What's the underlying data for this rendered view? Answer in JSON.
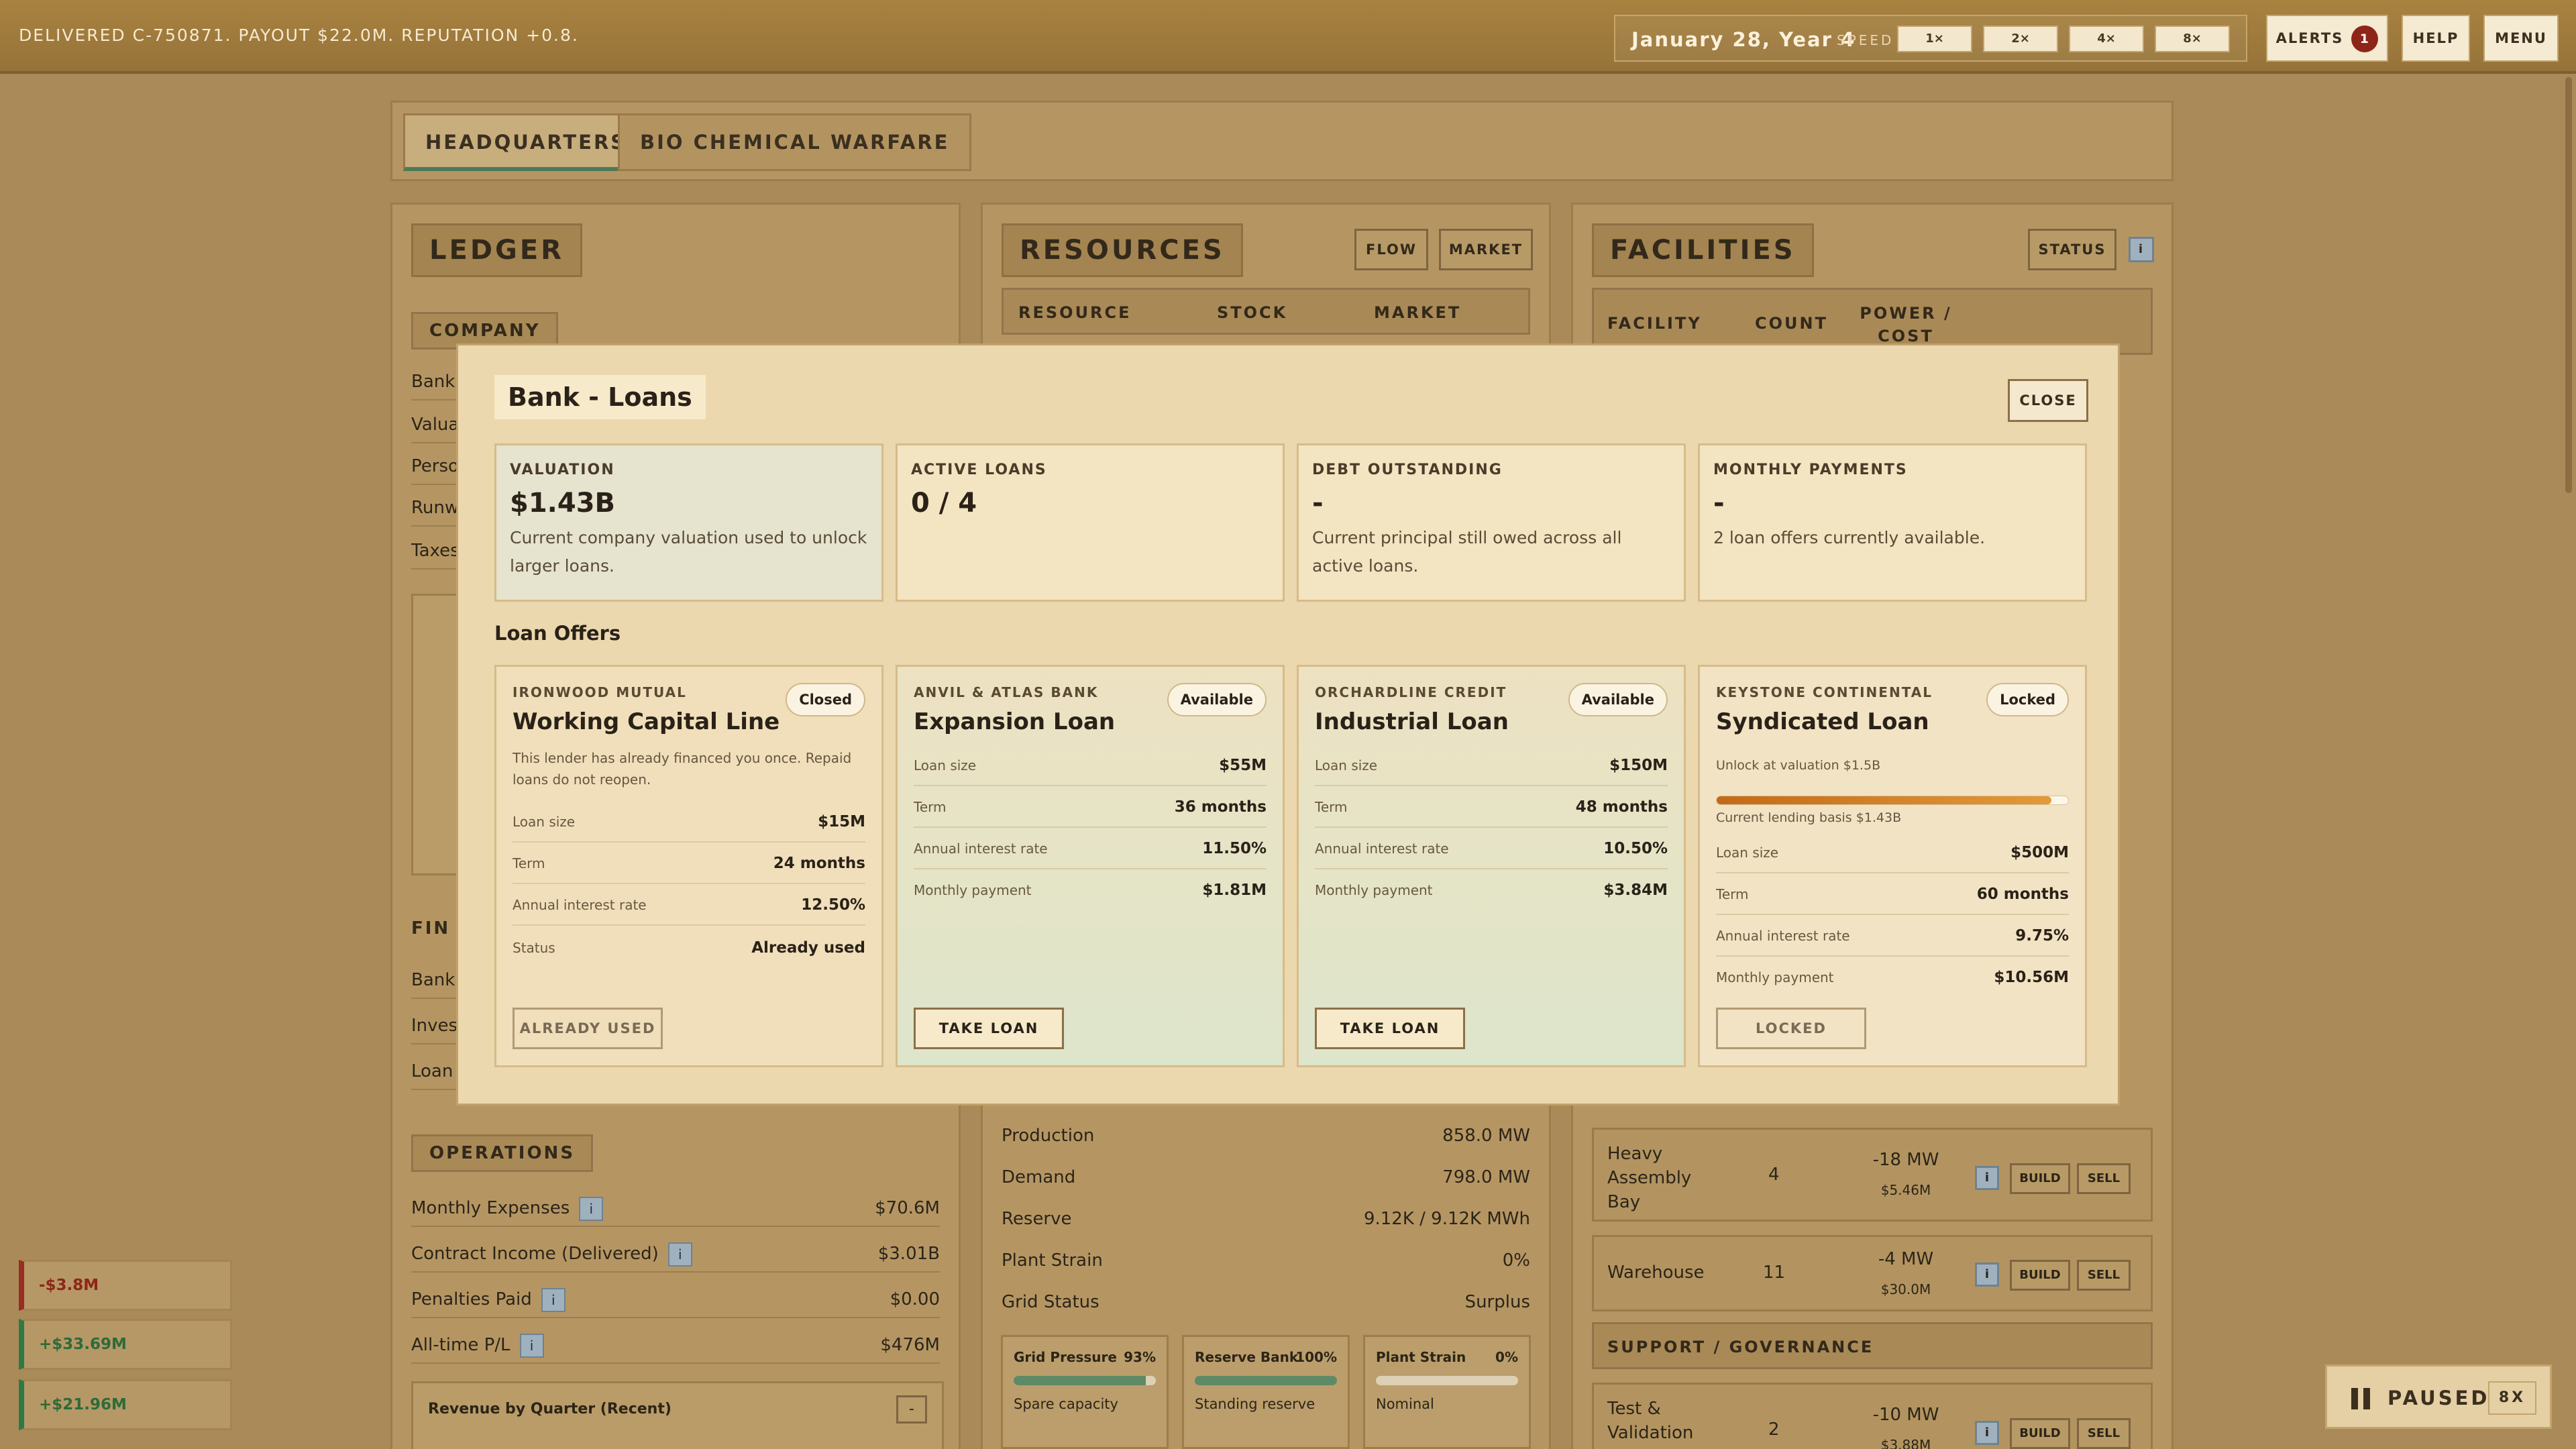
{
  "topbar": {
    "message": "DELIVERED C-750871. PAYOUT $22.0M. REPUTATION +0.8.",
    "date": "January 28, Year 4",
    "speed_label": "SPEED",
    "speeds": [
      "1×",
      "2×",
      "4×",
      "8×"
    ],
    "alerts_label": "ALERTS",
    "alerts_count": "1",
    "help_label": "HELP",
    "menu_label": "MENU"
  },
  "tabs": [
    "HEADQUARTERS",
    "BIO CHEMICAL WARFARE"
  ],
  "ledger": {
    "title": "LEDGER",
    "company_section": "COMPANY",
    "company_rows": [
      "Bank I",
      "Valuat",
      "Perso",
      "Runw",
      "Taxes"
    ],
    "finance_section": "FIN",
    "finance_rows": [
      "Bank I",
      "Invest",
      "Loan I"
    ],
    "operations_section": "OPERATIONS",
    "operations": [
      {
        "label": "Monthly Expenses",
        "value": "$70.6M"
      },
      {
        "label": "Contract Income (Delivered)",
        "value": "$3.01B"
      },
      {
        "label": "Penalties Paid",
        "value": "$0.00"
      },
      {
        "label": "All-time P/L",
        "value": "$476M"
      }
    ],
    "revenue_chart_title": "Revenue by Quarter (Recent)",
    "revenue_chart_btn": "-",
    "info_glyph": "i"
  },
  "resources": {
    "title": "RESOURCES",
    "flow_btn": "FLOW",
    "market_btn": "MARKET",
    "columns": [
      "RESOURCE",
      "STOCK",
      "MARKET"
    ],
    "power_rows": [
      {
        "label": "Production",
        "value": "858.0 MW"
      },
      {
        "label": "Demand",
        "value": "798.0 MW"
      },
      {
        "label": "Reserve",
        "value": "9.12K / 9.12K MWh"
      },
      {
        "label": "Plant Strain",
        "value": "0%"
      },
      {
        "label": "Grid Status",
        "value": "Surplus"
      }
    ],
    "gauges": [
      {
        "label": "Grid Pressure",
        "pct": "93%",
        "fill": 0.93,
        "note": "Spare capacity"
      },
      {
        "label": "Reserve Bank",
        "pct": "100%",
        "fill": 1.0,
        "note": "Standing reserve"
      },
      {
        "label": "Plant Strain",
        "pct": "0%",
        "fill": 0.0,
        "note": "Nominal"
      }
    ]
  },
  "facilities": {
    "title": "FACILITIES",
    "status_btn": "STATUS",
    "info_glyph": "i",
    "columns": [
      "FACILITY",
      "COUNT",
      "POWER / COST"
    ],
    "rows": [
      {
        "name": "Heavy Assembly Bay",
        "count": "4",
        "power": "-18 MW",
        "cost": "$5.46M"
      },
      {
        "name": "Warehouse",
        "count": "11",
        "power": "-4 MW",
        "cost": "$30.0M"
      }
    ],
    "support_section": "SUPPORT / GOVERNANCE",
    "support_rows": [
      {
        "name": "Test & Validation Range",
        "count": "2",
        "power": "-10 MW",
        "cost": "$3.88M"
      }
    ],
    "build_label": "BUILD",
    "sell_label": "SELL"
  },
  "toasts": [
    "-$3.8M",
    "+$33.69M",
    "+$21.96M"
  ],
  "paused": {
    "label": "PAUSED",
    "speed": "8X"
  },
  "modal": {
    "title": "Bank - Loans",
    "close_label": "CLOSE",
    "stats": [
      {
        "label": "VALUATION",
        "value": "$1.43B",
        "desc": "Current company valuation used to unlock larger loans."
      },
      {
        "label": "ACTIVE LOANS",
        "value": "0 / 4",
        "desc": ""
      },
      {
        "label": "DEBT OUTSTANDING",
        "value": "-",
        "desc": "Current principal still owed across all active loans."
      },
      {
        "label": "MONTHLY PAYMENTS",
        "value": "-",
        "desc": "2 loan offers currently available."
      }
    ],
    "offers_heading": "Loan Offers",
    "offers": [
      {
        "lender": "IRONWOOD MUTUAL",
        "name": "Working Capital Line",
        "status": "Closed",
        "note": "This lender has already financed you once. Repaid loans do not reopen.",
        "rows": [
          {
            "label": "Loan size",
            "value": "$15M"
          },
          {
            "label": "Term",
            "value": "24 months"
          },
          {
            "label": "Annual interest rate",
            "value": "12.50%"
          },
          {
            "label": "Status",
            "value": "Already used"
          }
        ],
        "button": "ALREADY USED"
      },
      {
        "lender": "ANVIL & ATLAS BANK",
        "name": "Expansion Loan",
        "status": "Available",
        "rows": [
          {
            "label": "Loan size",
            "value": "$55M"
          },
          {
            "label": "Term",
            "value": "36 months"
          },
          {
            "label": "Annual interest rate",
            "value": "11.50%"
          },
          {
            "label": "Monthly payment",
            "value": "$1.81M"
          }
        ],
        "button": "TAKE LOAN"
      },
      {
        "lender": "ORCHARDLINE CREDIT",
        "name": "Industrial Loan",
        "status": "Available",
        "rows": [
          {
            "label": "Loan size",
            "value": "$150M"
          },
          {
            "label": "Term",
            "value": "48 months"
          },
          {
            "label": "Annual interest rate",
            "value": "10.50%"
          },
          {
            "label": "Monthly payment",
            "value": "$3.84M"
          }
        ],
        "button": "TAKE LOAN"
      },
      {
        "lender": "KEYSTONE CONTINENTAL",
        "name": "Syndicated Loan",
        "status": "Locked",
        "unlock": "Unlock at valuation $1.5B",
        "progress": 0.953,
        "basis": "Current lending basis $1.43B",
        "rows": [
          {
            "label": "Loan size",
            "value": "$500M"
          },
          {
            "label": "Term",
            "value": "60 months"
          },
          {
            "label": "Annual interest rate",
            "value": "9.75%"
          },
          {
            "label": "Monthly payment",
            "value": "$10.56M"
          }
        ],
        "button": "LOCKED"
      }
    ]
  }
}
